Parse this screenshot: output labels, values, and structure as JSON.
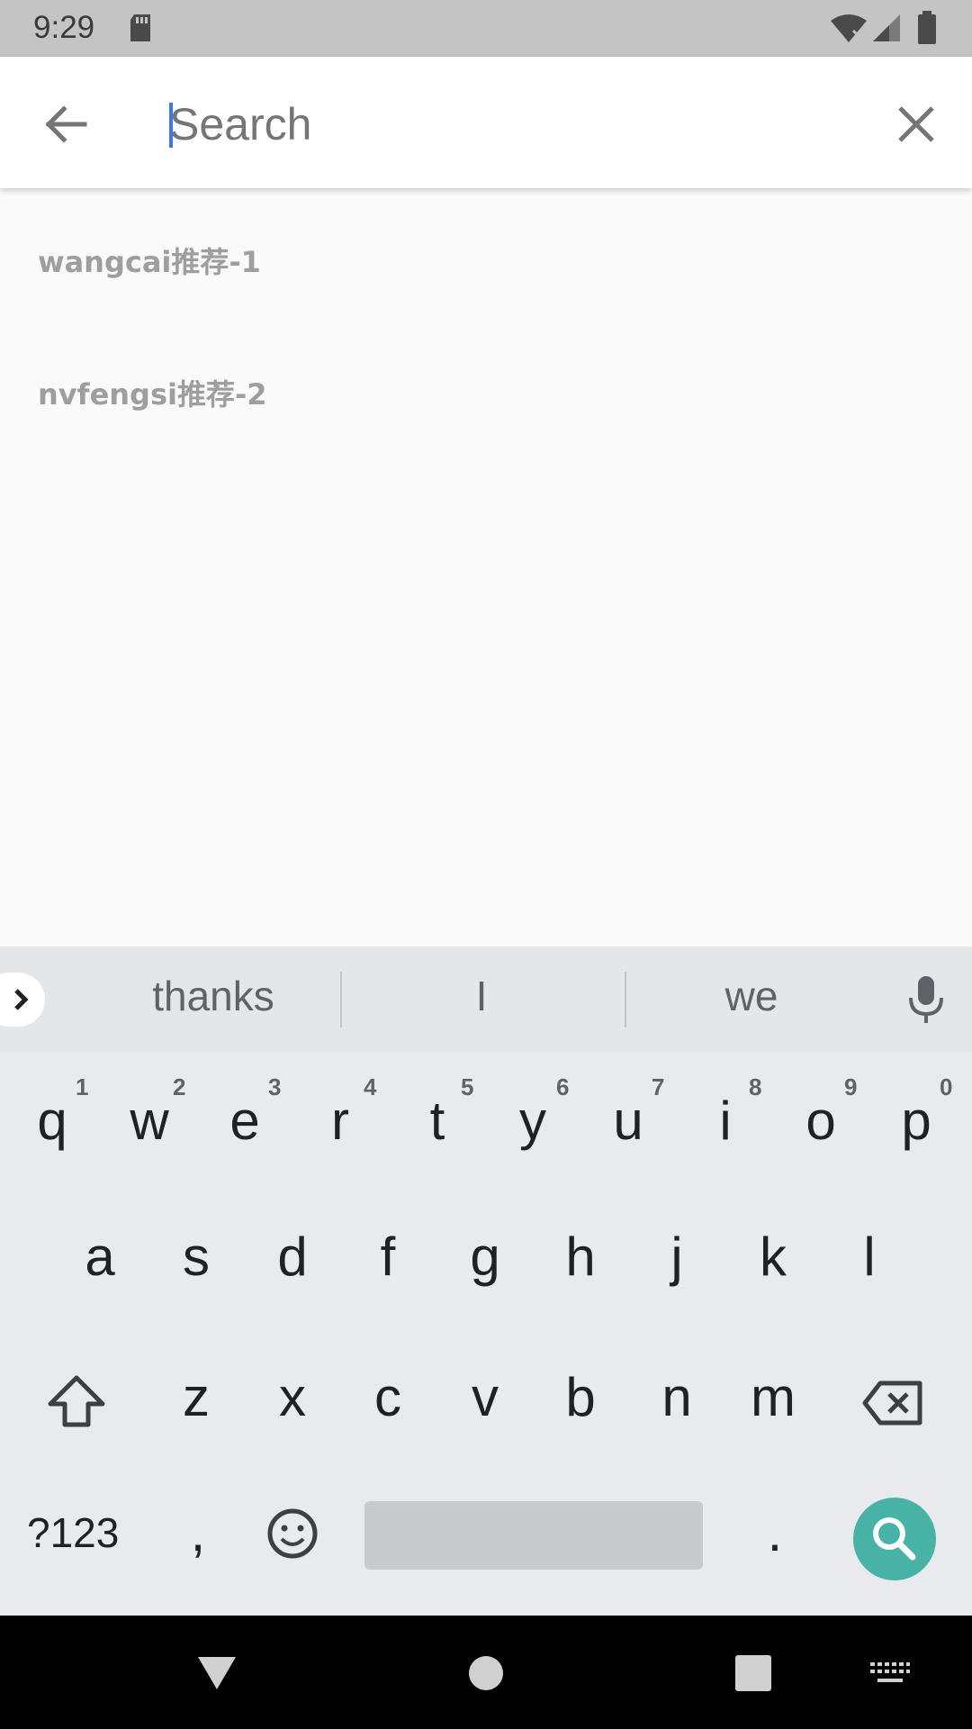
{
  "status_bar": {
    "time": "9:29"
  },
  "search": {
    "placeholder": "Search",
    "value": ""
  },
  "suggestions": [
    {
      "label": "wangcai推荐-1"
    },
    {
      "label": "nvfengsi推荐-2"
    }
  ],
  "keyboard": {
    "strip_words": [
      "thanks",
      "I",
      "we"
    ],
    "row1": [
      {
        "letter": "q",
        "hint": "1"
      },
      {
        "letter": "w",
        "hint": "2"
      },
      {
        "letter": "e",
        "hint": "3"
      },
      {
        "letter": "r",
        "hint": "4"
      },
      {
        "letter": "t",
        "hint": "5"
      },
      {
        "letter": "y",
        "hint": "6"
      },
      {
        "letter": "u",
        "hint": "7"
      },
      {
        "letter": "i",
        "hint": "8"
      },
      {
        "letter": "o",
        "hint": "9"
      },
      {
        "letter": "p",
        "hint": "0"
      }
    ],
    "row2": [
      "a",
      "s",
      "d",
      "f",
      "g",
      "h",
      "j",
      "k",
      "l"
    ],
    "row3": [
      "z",
      "x",
      "c",
      "v",
      "b",
      "n",
      "m"
    ],
    "symbols_label": "?123",
    "comma_label": ",",
    "period_label": "."
  },
  "colors": {
    "accent": "#3b78e7",
    "search_key": "#47b3a7",
    "status_bar": "#c4c4c4"
  }
}
